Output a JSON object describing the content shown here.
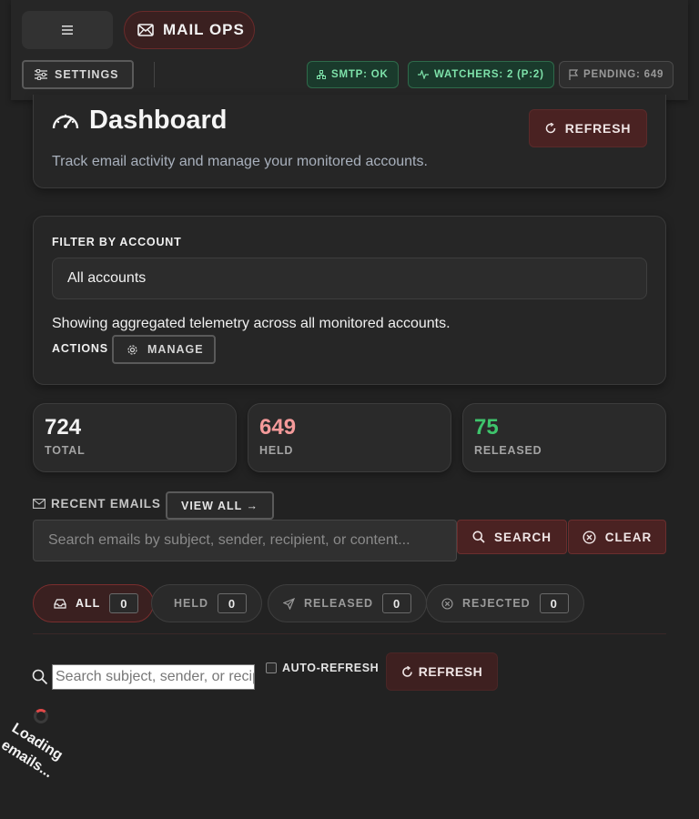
{
  "header": {
    "menu_icon": "hamburger-icon",
    "brand_label": "MAIL OPS",
    "brand_icon": "envelope-icon",
    "settings_label": "SETTINGS",
    "status": {
      "smtp": "SMTP: OK",
      "watchers": "WATCHERS: 2 (P:2)",
      "pending": "PENDING: 649"
    }
  },
  "dashboard": {
    "title": "Dashboard",
    "subtitle": "Track email activity and manage your monitored accounts.",
    "refresh_label": "REFRESH"
  },
  "filter": {
    "label": "FILTER BY ACCOUNT",
    "selected": "All accounts",
    "note": "Showing aggregated telemetry across all monitored accounts.",
    "actions_label": "ACTIONS",
    "manage_label": "MANAGE"
  },
  "stats": [
    {
      "value": "724",
      "label": "TOTAL",
      "color": "#f2f2f2"
    },
    {
      "value": "649",
      "label": "HELD",
      "color": "#f49a9a"
    },
    {
      "value": "75",
      "label": "RELEASED",
      "color": "#3ec46c"
    }
  ],
  "recent": {
    "label": "RECENT EMAILS",
    "view_all_label": "VIEW ALL →",
    "search_placeholder": "Search emails by subject, sender, recipient, or content...",
    "search_label": "SEARCH",
    "clear_label": "CLEAR"
  },
  "tabs": [
    {
      "label": "ALL",
      "count": "0",
      "icon": "inbox-icon"
    },
    {
      "label": "HELD",
      "count": "0",
      "icon": ""
    },
    {
      "label": "RELEASED",
      "count": "0",
      "icon": "send-icon"
    },
    {
      "label": "REJECTED",
      "count": "0",
      "icon": "x-circle-icon"
    }
  ],
  "list_controls": {
    "search_placeholder": "Search subject, sender, or recipient",
    "auto_refresh_label": "AUTO-REFRESH",
    "refresh_label": "REFRESH"
  },
  "loading_text": "Loading emails..."
}
